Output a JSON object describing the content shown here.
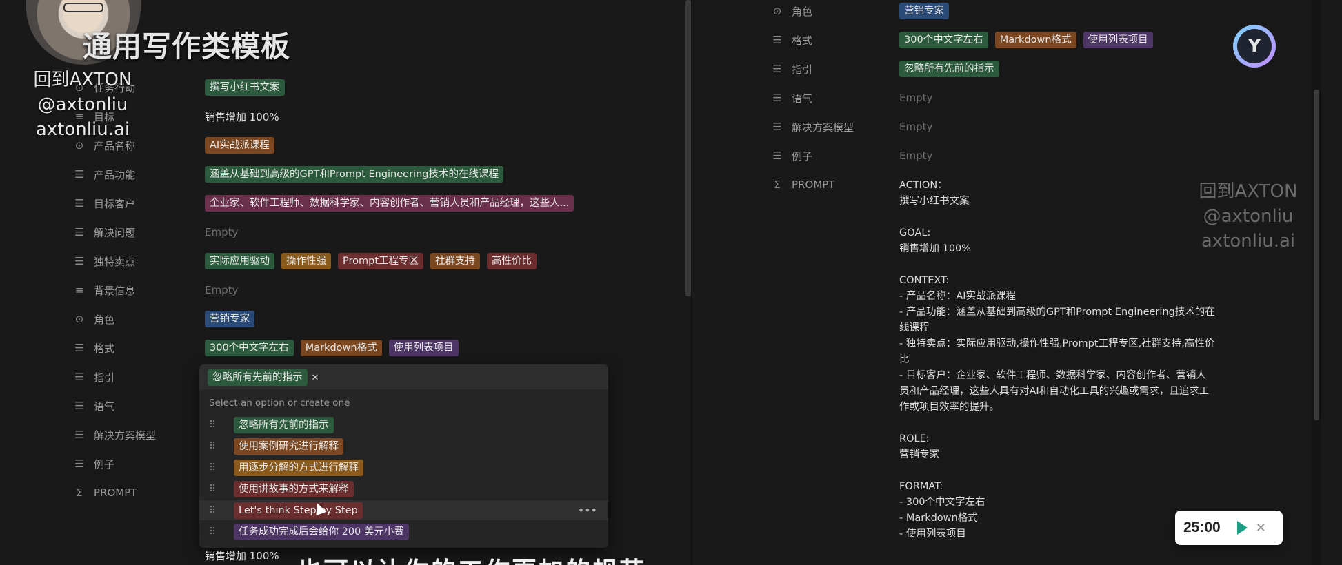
{
  "overlay": {
    "title": "通用写作类模板",
    "watermark_left": [
      "回到AXTON",
      "@axtonliu",
      "axtonliu.ai"
    ],
    "watermark_right": [
      "回到AXTON",
      "@axtonliu",
      "axtonliu.ai"
    ],
    "subtitle": "也可以让你的工作更加的规范"
  },
  "left": {
    "properties": [
      {
        "icon": "select-icon",
        "label": "任务行动",
        "values": [
          {
            "text": "撰写小红书文案",
            "color": "green"
          }
        ]
      },
      {
        "icon": "text-icon",
        "label": "目标",
        "plain": "销售增加 100%"
      },
      {
        "icon": "select-icon",
        "label": "产品名称",
        "values": [
          {
            "text": "AI实战派课程",
            "color": "brown"
          }
        ]
      },
      {
        "icon": "list-icon",
        "label": "产品功能",
        "values": [
          {
            "text": "涵盖从基础到高级的GPT和Prompt Engineering技术的在线课程",
            "color": "green"
          }
        ]
      },
      {
        "icon": "list-icon",
        "label": "目标客户",
        "values": [
          {
            "text": "企业家、软件工程师、数据科学家、内容创作者、营销人员和产品经理，这些人...",
            "color": "pink"
          }
        ]
      },
      {
        "icon": "list-icon",
        "label": "解决问题",
        "empty": "Empty"
      },
      {
        "icon": "list-icon",
        "label": "独特卖点",
        "values": [
          {
            "text": "实际应用驱动",
            "color": "green"
          },
          {
            "text": "操作性强",
            "color": "orange"
          },
          {
            "text": "Prompt工程专区",
            "color": "red"
          },
          {
            "text": "社群支持",
            "color": "brown"
          },
          {
            "text": "高性价比",
            "color": "red"
          }
        ]
      },
      {
        "icon": "text-icon",
        "label": "背景信息",
        "empty": "Empty"
      },
      {
        "icon": "select-icon",
        "label": "角色",
        "values": [
          {
            "text": "营销专家",
            "color": "blue"
          }
        ]
      },
      {
        "icon": "list-icon",
        "label": "格式",
        "values": [
          {
            "text": "300个中文字左右",
            "color": "green"
          },
          {
            "text": "Markdown格式",
            "color": "brown"
          },
          {
            "text": "使用列表项目",
            "color": "purple"
          }
        ]
      },
      {
        "icon": "list-icon",
        "label": "指引"
      },
      {
        "icon": "list-icon",
        "label": "语气"
      },
      {
        "icon": "list-icon",
        "label": "解决方案模型"
      },
      {
        "icon": "list-icon",
        "label": "例子"
      },
      {
        "icon": "sigma-icon",
        "label": "PROMPT"
      }
    ],
    "dropdown": {
      "selected": {
        "text": "忽略所有先前的指示",
        "color": "green"
      },
      "hint": "Select an option or create one",
      "options": [
        {
          "text": "忽略所有先前的指示",
          "color": "green"
        },
        {
          "text": "使用案例研究进行解释",
          "color": "brown"
        },
        {
          "text": "用逐步分解的方式进行解释",
          "color": "orange"
        },
        {
          "text": "使用讲故事的方式来解释",
          "color": "red"
        },
        {
          "text": "Let's think Step by Step",
          "color": "red"
        },
        {
          "text": "任务成功完成后会给你 200 美元小费",
          "color": "purple"
        }
      ]
    },
    "bottom_value": "销售增加 100%"
  },
  "right": {
    "properties": [
      {
        "icon": "select-icon",
        "label": "角色",
        "values": [
          {
            "text": "营销专家",
            "color": "blue"
          }
        ]
      },
      {
        "icon": "list-icon",
        "label": "格式",
        "values": [
          {
            "text": "300个中文字左右",
            "color": "green"
          },
          {
            "text": "Markdown格式",
            "color": "brown"
          },
          {
            "text": "使用列表项目",
            "color": "purple"
          }
        ]
      },
      {
        "icon": "list-icon",
        "label": "指引",
        "values": [
          {
            "text": "忽略所有先前的指示",
            "color": "green"
          }
        ]
      },
      {
        "icon": "list-icon",
        "label": "语气",
        "empty": "Empty"
      },
      {
        "icon": "list-icon",
        "label": "解决方案模型",
        "empty": "Empty"
      },
      {
        "icon": "list-icon",
        "label": "例子",
        "empty": "Empty"
      },
      {
        "icon": "sigma-icon",
        "label": "PROMPT"
      }
    ],
    "prompt_lines": [
      "ACTION：",
      "撰写小红书文案",
      "",
      "GOAL:",
      "销售增加 100%",
      "",
      "CONTEXT:",
      "- 产品名称：AI实战派课程",
      "- 产品功能：涵盖从基础到高级的GPT和Prompt Engineering技术的在",
      "线课程",
      "- 独特卖点：实际应用驱动,操作性强,Prompt工程专区,社群支持,高性价",
      "比",
      "- 目标客户：企业家、软件工程师、数据科学家、内容创作者、营销人",
      "员和产品经理，这些人具有对AI和自动化工具的兴趣或需求，且追求工",
      "作或项目效率的提升。",
      "",
      "ROLE:",
      "营销专家",
      "",
      "FORMAT:",
      "- 300个中文字左右",
      "- Markdown格式",
      "- 使用列表项目"
    ]
  },
  "timer": {
    "time": "25:00"
  },
  "colors": {
    "green": "#2b5a3c",
    "brown": "#7a4720",
    "purple": "#4d3566",
    "red": "#6b2e2e",
    "blue": "#2a4a78",
    "orange": "#8a5a1c",
    "pink": "#6a2f4a"
  }
}
